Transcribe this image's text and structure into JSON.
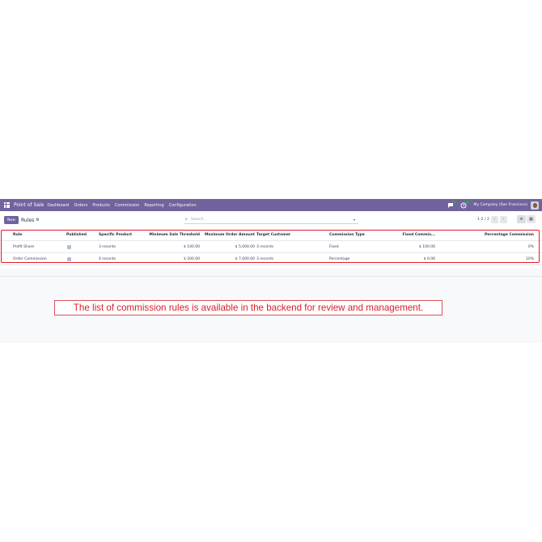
{
  "navbar": {
    "app_name": "Point of Sale",
    "menu": [
      "Dashboard",
      "Orders",
      "Products",
      "Commission",
      "Reporting",
      "Configuration"
    ],
    "company": "My Company (San Francisco)",
    "chat_badge": "5",
    "activity_badge": "1"
  },
  "control": {
    "new_label": "New",
    "breadcrumb": "Rules",
    "search_placeholder": "Search...",
    "pager": "1-2 / 2"
  },
  "table": {
    "headers": {
      "rule": "Rule",
      "published": "Published",
      "specific_product": "Specific Product",
      "min_threshold": "Minimum Sale Threshold",
      "max_amount": "Maximum Order Amount",
      "target_customer": "Target Customer",
      "commission_type": "Commission Type",
      "fixed_commission": "Fixed Commis...",
      "percentage_commission": "Percentage Commission"
    },
    "rows": [
      {
        "rule": "Profit Share",
        "specific_product": "3 records",
        "min_threshold": "$ 100.00",
        "max_amount": "$ 5,000.00",
        "target_customer": "3 records",
        "commission_type": "Fixed",
        "fixed_commission": "$ 100.00",
        "percentage_commission": "0%"
      },
      {
        "rule": "Order Commission",
        "specific_product": "4 records",
        "min_threshold": "$ 200.00",
        "max_amount": "$ 7,000.00",
        "target_customer": "3 records",
        "commission_type": "Percentage",
        "fixed_commission": "$ 0.00",
        "percentage_commission": "10%"
      }
    ]
  },
  "caption": "The list of commission rules is available in the backend for review and management.",
  "colors": {
    "navbar": "#71639e",
    "highlight": "#e11d2a"
  }
}
